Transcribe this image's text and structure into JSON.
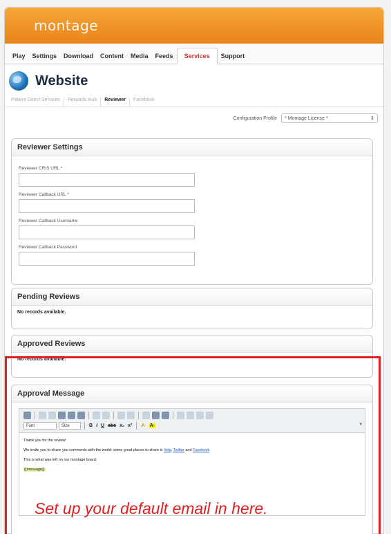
{
  "app": {
    "logo": "montage"
  },
  "nav": [
    "Play",
    "Settings",
    "Download",
    "Content",
    "Media",
    "Feeds",
    "Services",
    "Support"
  ],
  "active_nav": "Services",
  "page_title": "Website",
  "subtabs": [
    "Patient Direct Services",
    "Rewards Hub",
    "Reviewer",
    "Facebook"
  ],
  "active_subtab": "Reviewer",
  "config": {
    "label": "Configuration Profile",
    "value": "* Montage License *"
  },
  "reviewer_settings": {
    "title": "Reviewer Settings",
    "fields": [
      {
        "label": "Reviewer CRIS URL *",
        "value": ""
      },
      {
        "label": "Reviewer Callback URL *",
        "value": ""
      },
      {
        "label": "Reviewer Callback Username",
        "value": ""
      },
      {
        "label": "Reviewer Callback Password",
        "value": ""
      }
    ]
  },
  "pending_reviews": {
    "title": "Pending Reviews",
    "empty": "No records available."
  },
  "approved_reviews": {
    "title": "Approved Reviews",
    "empty": "No records available."
  },
  "approval_message": {
    "title": "Approval Message",
    "font_combo": "Font",
    "size_combo": "Size",
    "format_buttons": [
      "B",
      "I",
      "U",
      "abc",
      "x₂",
      "x²",
      "A·",
      "A·"
    ],
    "line1": "Thank you for the review!",
    "line2_prefix": "We invite you to share you comments with the world: some great places to share is",
    "link1": "Yelp",
    "link2": "Twitter",
    "link2_sep": ",",
    "and": "and",
    "link3": "Facebook",
    "line3": "This is what was left on our montage board:",
    "placeholder": "{{message}}"
  },
  "callout": "Set up your default email in here.",
  "colors": {
    "accent": "#e8841a",
    "highlight": "#e02020",
    "link": "#1e53c8"
  }
}
